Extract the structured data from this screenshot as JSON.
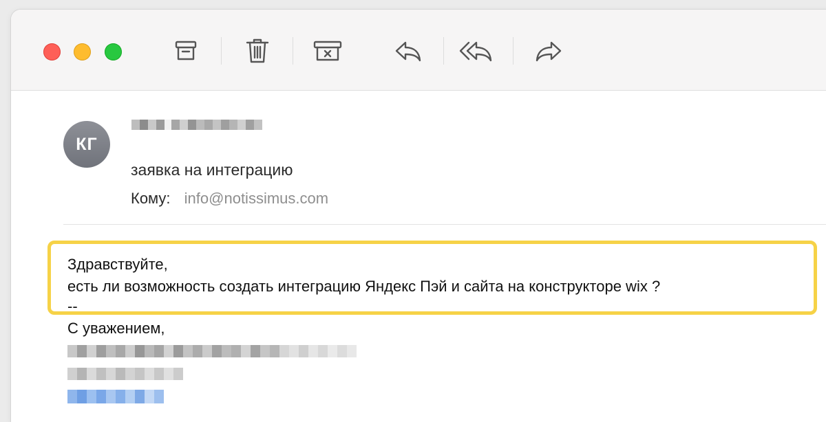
{
  "toolbar": {
    "traffic_lights": [
      "close",
      "minimize",
      "zoom"
    ],
    "buttons": [
      {
        "name": "archive",
        "icon": "archive-box-icon"
      },
      {
        "name": "delete",
        "icon": "trash-icon"
      },
      {
        "name": "junk",
        "icon": "junk-box-icon"
      },
      {
        "name": "reply",
        "icon": "reply-arrow-icon"
      },
      {
        "name": "reply-all",
        "icon": "reply-all-arrow-icon"
      },
      {
        "name": "forward",
        "icon": "forward-arrow-icon"
      }
    ]
  },
  "message": {
    "avatar_initials": "КГ",
    "subject": "заявка на интеграцию",
    "to_label": "Кому:",
    "to_address": "info@notissimus.com"
  },
  "body": {
    "greeting": "Здравствуйте,",
    "question": "есть ли возможность создать интеграцию Яндекс Пэй и сайта на конструкторе wix ?",
    "separator": "--",
    "sign_off": "С уважением,"
  },
  "colors": {
    "highlight_border": "#f6d247",
    "avatar_bg": "#7d8088",
    "link_blur": "#7aa7e8"
  }
}
